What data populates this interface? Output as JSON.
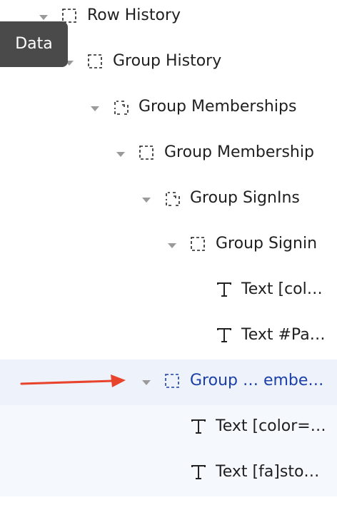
{
  "tooltip": {
    "text": "Data"
  },
  "tree": {
    "items": [
      {
        "label": "Row History",
        "kind": "repeater",
        "icon": "dashed-square-icon"
      },
      {
        "label": "Group History",
        "kind": "repeater",
        "icon": "dashed-square-icon"
      },
      {
        "label": "Group Memberships",
        "kind": "group",
        "icon": "dashed-group-icon"
      },
      {
        "label": "Group Membership",
        "kind": "repeater",
        "icon": "dashed-square-icon"
      },
      {
        "label": "Group SignIns",
        "kind": "group",
        "icon": "dashed-group-icon"
      },
      {
        "label": "Group Signin",
        "kind": "repeater",
        "icon": "dashed-square-icon"
      },
      {
        "label": "Text [col…",
        "kind": "text",
        "icon": "text-icon"
      },
      {
        "label": "Text #Pa…",
        "kind": "text",
        "icon": "text-icon"
      },
      {
        "label": "Group … embe…",
        "kind": "repeater",
        "icon": "dashed-square-icon",
        "selected": true
      },
      {
        "label": "Text [color=…",
        "kind": "text",
        "icon": "text-icon"
      },
      {
        "label": "Text [fa]sto…",
        "kind": "text",
        "icon": "text-icon"
      }
    ]
  },
  "colors": {
    "selected_row_bg": "#eef2fb",
    "selected_text": "#1a3fa8",
    "tooltip_bg": "#4a4a4a",
    "arrow": "#e8432b",
    "caret": "#9a9a9a"
  }
}
